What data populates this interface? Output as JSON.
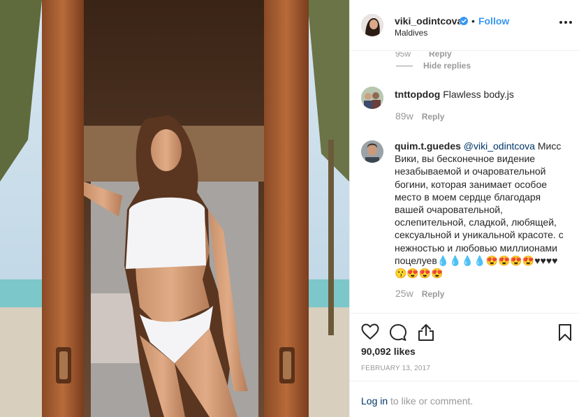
{
  "post": {
    "username": "viki_odintcova",
    "separator": "•",
    "follow_label": "Follow",
    "location": "Maldives",
    "more_icon": "more-horizontal-icon",
    "verified_icon": "verified-badge-icon",
    "verified_color": "#3897f0"
  },
  "comments": {
    "partial_time": "95w",
    "partial_reply": "Reply",
    "hide_replies": "Hide replies",
    "items": [
      {
        "user": "tnttopdog",
        "text": "Flawless body.js",
        "time": "89w",
        "reply": "Reply"
      },
      {
        "user": "quim.t.guedes",
        "mention": "@viki_odintcova",
        "text": "Мисс Вики, вы бесконечное видение незабываемой и очаровательной богини, которая занимает особое место в моем сердце благодаря вашей очаровательной, ослепительной, сладкой, любящей, сексуальной и уникальной красоте. с нежностью и любовью миллионами поцелуев💧💧💧💧😍😍😍😍♥♥♥♥😗😍😍😍",
        "time": "25w",
        "reply": "Reply"
      }
    ]
  },
  "actions": {
    "like_icon": "heart-icon",
    "comment_icon": "comment-icon",
    "share_icon": "share-icon",
    "save_icon": "bookmark-icon"
  },
  "likes": "90,092 likes",
  "date": "February 13, 2017",
  "footer": {
    "login_link": "Log in",
    "login_text": " to like or comment."
  },
  "colors": {
    "link": "#3897f0",
    "mention": "#003569",
    "muted": "#999999",
    "border": "#efefef"
  }
}
